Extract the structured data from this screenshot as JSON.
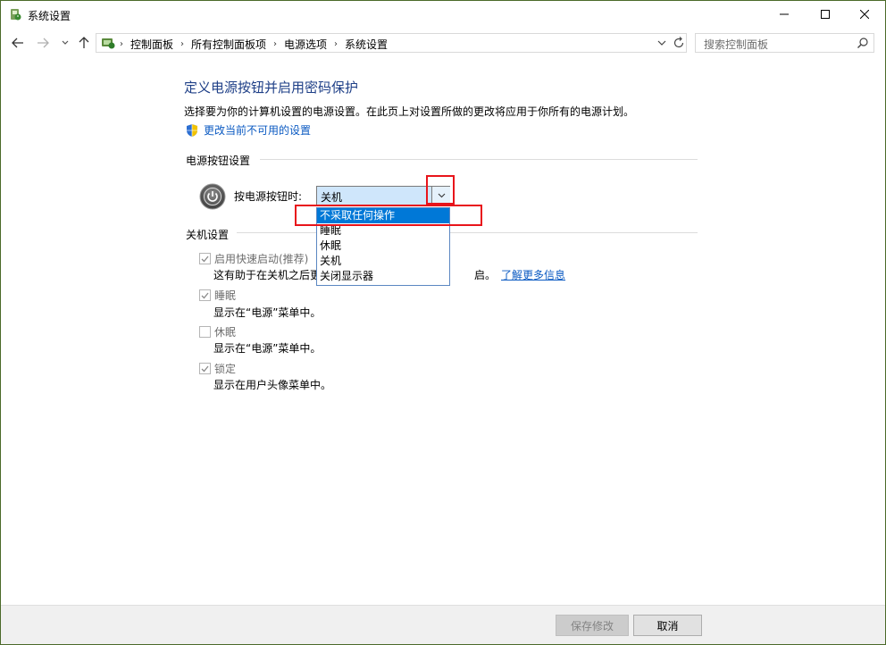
{
  "window": {
    "title": "系统设置"
  },
  "breadcrumb": [
    "控制面板",
    "所有控制面板项",
    "电源选项",
    "系统设置"
  ],
  "search": {
    "placeholder": "搜索控制面板"
  },
  "page": {
    "title": "定义电源按钮并启用密码保护",
    "description": "选择要为你的计算机设置的电源设置。在此页上对设置所做的更改将应用于你所有的电源计划。",
    "change_link": "更改当前不可用的设置"
  },
  "power_section": {
    "heading": "电源按钮设置",
    "label": "按电源按钮时:",
    "selected": "关机",
    "options": [
      "不采取任何操作",
      "睡眠",
      "休眠",
      "关机",
      "关闭显示器"
    ]
  },
  "shutdown_section": {
    "heading": "关机设置",
    "items": [
      {
        "label": "启用快速启动(推荐)",
        "checked": true,
        "desc_prefix": "这有助于在关机之后更",
        "desc_suffix": "启。",
        "link": "了解更多信息"
      },
      {
        "label": "睡眠",
        "checked": true,
        "desc": "显示在“电源”菜单中。"
      },
      {
        "label": "休眠",
        "checked": false,
        "desc": "显示在“电源”菜单中。"
      },
      {
        "label": "锁定",
        "checked": true,
        "desc": "显示在用户头像菜单中。"
      }
    ]
  },
  "footer": {
    "save": "保存修改",
    "cancel": "取消"
  },
  "colors": {
    "accent": "#0078d7",
    "title": "#1e3f87",
    "link": "#0b5ac2",
    "highlight": "#e8141b"
  }
}
